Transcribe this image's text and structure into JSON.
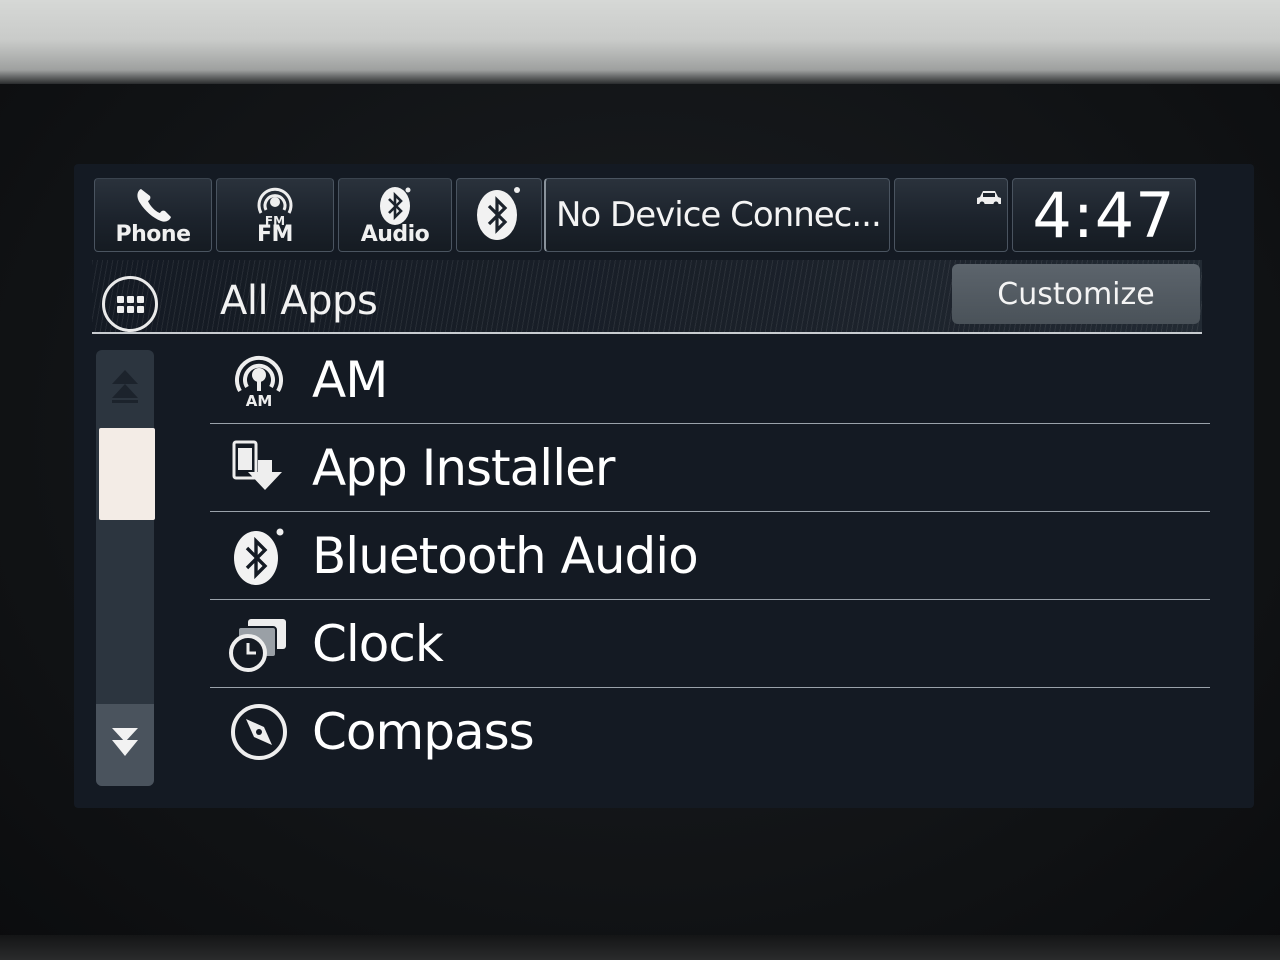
{
  "status_bar": {
    "phone": {
      "label": "Phone",
      "icon": "phone-icon"
    },
    "fm": {
      "label": "FM",
      "icon_text": "FM",
      "icon": "fm-radio-icon"
    },
    "audio": {
      "label": "Audio",
      "icon": "bluetooth-audio-icon"
    },
    "bluetooth": {
      "icon": "bluetooth-icon"
    },
    "device_status": "No Device Connec...",
    "vehicle": {
      "icon": "car-icon"
    },
    "time": "4:47"
  },
  "header": {
    "title": "All Apps",
    "apps_button_icon": "apps-grid-icon",
    "customize_label": "Customize"
  },
  "scrollbar": {
    "up_icon": "scroll-top-icon",
    "down_icon": "scroll-down-icon"
  },
  "apps": [
    {
      "label": "AM",
      "icon": "am-radio-icon",
      "icon_text": "AM"
    },
    {
      "label": "App Installer",
      "icon": "app-installer-icon"
    },
    {
      "label": "Bluetooth Audio",
      "icon": "bluetooth-audio-icon"
    },
    {
      "label": "Clock",
      "icon": "clock-icon"
    },
    {
      "label": "Compass",
      "icon": "compass-icon"
    }
  ]
}
